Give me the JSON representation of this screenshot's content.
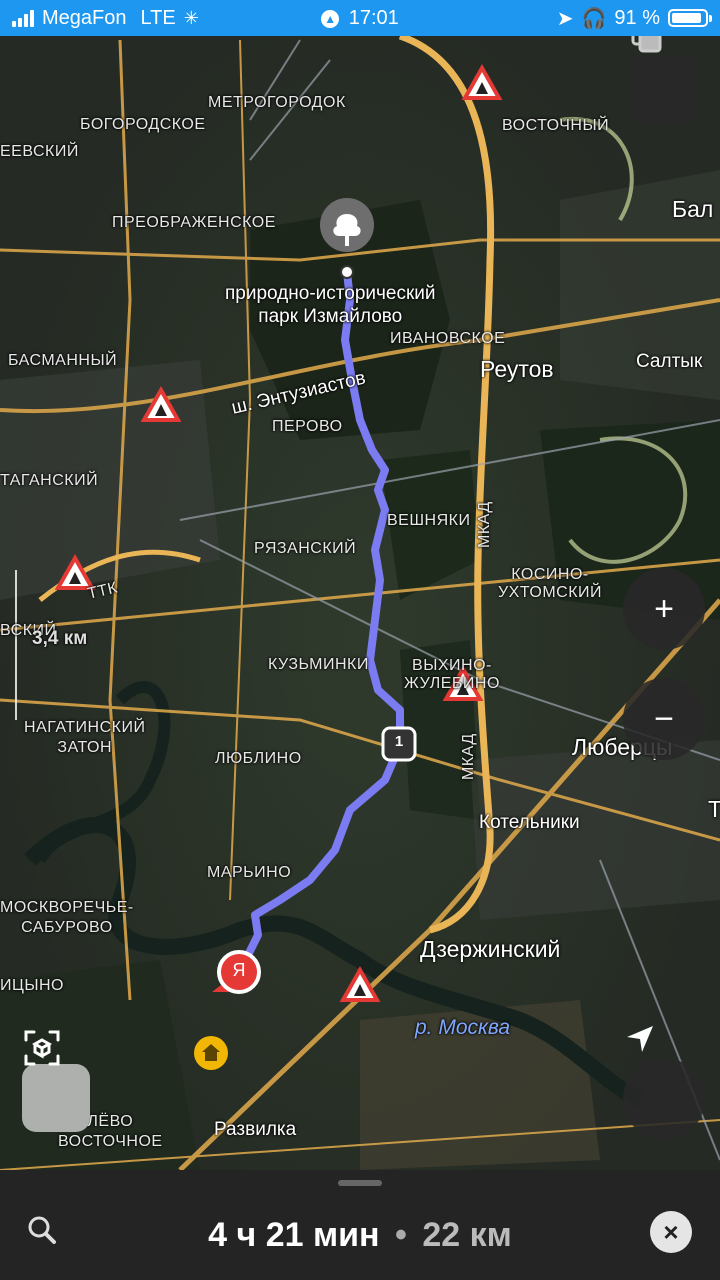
{
  "status_bar": {
    "carrier": "MegaFon",
    "network": "LTE",
    "time": "17:01",
    "battery": "91 %",
    "battery_level": 0.91
  },
  "map": {
    "labels": {
      "metrogorodok": "МЕТРОГОРОДОК",
      "bogorodskoe": "БОГОРОДСКОЕ",
      "vostochny": "ВОСТОЧНЫЙ",
      "eevsky": "ЕЕВСКИЙ",
      "preobrazhenskoe": "ПРЕОБРАЖЕНСКОЕ",
      "bal": "Бал",
      "park": "природно-исторический\nпарк Измайлово",
      "ivanovskoe": "ИВАНОВСКОЕ",
      "reutov": "Реутов",
      "saltyk": "Салтык",
      "basmanny": "БАСМАННЫЙ",
      "entuziastov": "ш. Энтузиастов",
      "perovo": "ПЕРОВО",
      "taganskiy": "ТАГАНСКИЙ",
      "veshnyaki": "ВЕШНЯКИ",
      "mkad_top": "МКАД",
      "ryazansky": "РЯЗАНСКИЙ",
      "kosino": "КОСИНО-\nУХТОМСКИЙ",
      "ttk": "ТТК",
      "vsky": "ВСКИЙ",
      "scale": "3,4 км",
      "kuzminki": "КУЗЬМИНКИ",
      "vykhino": "ВЫХИНО-\nЖУЛЕБИНО",
      "nagatinsky": "НАГАТИНСКИЙ\nЗАТОН",
      "lyublino": "ЛЮБЛИНО",
      "mkad_bottom": "МКАД",
      "lyubertsy": "Люберцы",
      "kotelniki": "Котельники",
      "maryino": "МАРЬИНО",
      "moskvorechye": "МОСКВОРЕЧЬЕ-\nСАБУРОВО",
      "dzerzhinsky": "Дзержинский",
      "tsyno": "ИЦЫНО",
      "river": "р. Москва",
      "biryulevo": "ЛЁВО\nВОСТОЧНОЕ",
      "razvilka": "Развилка",
      "t_edge": "Т"
    },
    "route_badge": "1",
    "me_marker": "Я",
    "route_color": "#7b7cf2"
  },
  "controls": {
    "zoom_in": "+",
    "zoom_out": "−"
  },
  "route_summary": {
    "duration": "4 ч 21 мин",
    "separator": "•",
    "distance": "22 км"
  }
}
